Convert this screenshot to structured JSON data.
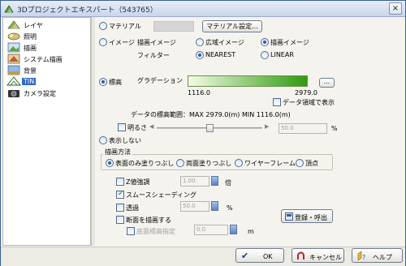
{
  "window": {
    "title": "3Dプロジェクトエキスパート（543765）",
    "close_glyph": "×"
  },
  "sidebar": {
    "items": [
      {
        "label": "レイヤ",
        "icon": "layer-icon"
      },
      {
        "label": "照明",
        "icon": "lighting-icon"
      },
      {
        "label": "描画",
        "icon": "drawing-icon"
      },
      {
        "label": "システム描画",
        "icon": "system-drawing-icon"
      },
      {
        "label": "背景",
        "icon": "background-icon"
      },
      {
        "label": "TIN",
        "icon": "tin-icon",
        "selected": true
      },
      {
        "label": "カメラ設定",
        "icon": "camera-icon"
      }
    ]
  },
  "source": {
    "material_label": "マテリアル",
    "material_button": "マテリアル設定...",
    "image_label": "イメージ",
    "draw_image_label": "描画イメージ",
    "wide_image_label": "広域イメージ",
    "draw_image_label2": "描画イメージ",
    "filter_label": "フィルター",
    "nearest_label": "NEAREST",
    "linear_label": "LINEAR"
  },
  "elevation": {
    "label": "標高",
    "gradation_label": "グラデーション",
    "gradation_button": "...",
    "min_value": "1116.0",
    "max_value": "2979.0",
    "show_data_range_label": "データ領域で表示",
    "range_text": "データの標高範囲：MAX 2979.0(m)  MIN 1116.0(m)",
    "gradient_colors": [
      "#f4fbe6",
      "#2e9b0e"
    ]
  },
  "brightness": {
    "label": "明るさ",
    "value": "50.0",
    "unit": "%",
    "slider_level_percent": 50
  },
  "hide_label": "表示しない",
  "draw_method": {
    "legend": "描画方法",
    "options": [
      "表面のみ塗りつぶし",
      "両面塗りつぶし",
      "ワイヤーフレーム",
      "頂点"
    ],
    "selected_index": 0
  },
  "options": {
    "z_emphasis_label": "Z値強調",
    "z_emphasis_value": "1.00",
    "z_emphasis_unit": "倍",
    "smooth_shading_label": "スムースシェーディング",
    "transparency_label": "透過",
    "transparency_value": "50.0",
    "transparency_unit": "%",
    "section_draw_label": "断面を描画する",
    "bottom_elev_label": "底面標高指定",
    "bottom_elev_value": "0.0",
    "bottom_elev_unit": "m",
    "register_button": "登録・呼出"
  },
  "buttons": {
    "ok": "OK",
    "cancel": "キャンセル",
    "help": "ヘルプ"
  },
  "colors": {
    "accent": "#316ac5",
    "title_bar": "#c9d5ea"
  }
}
